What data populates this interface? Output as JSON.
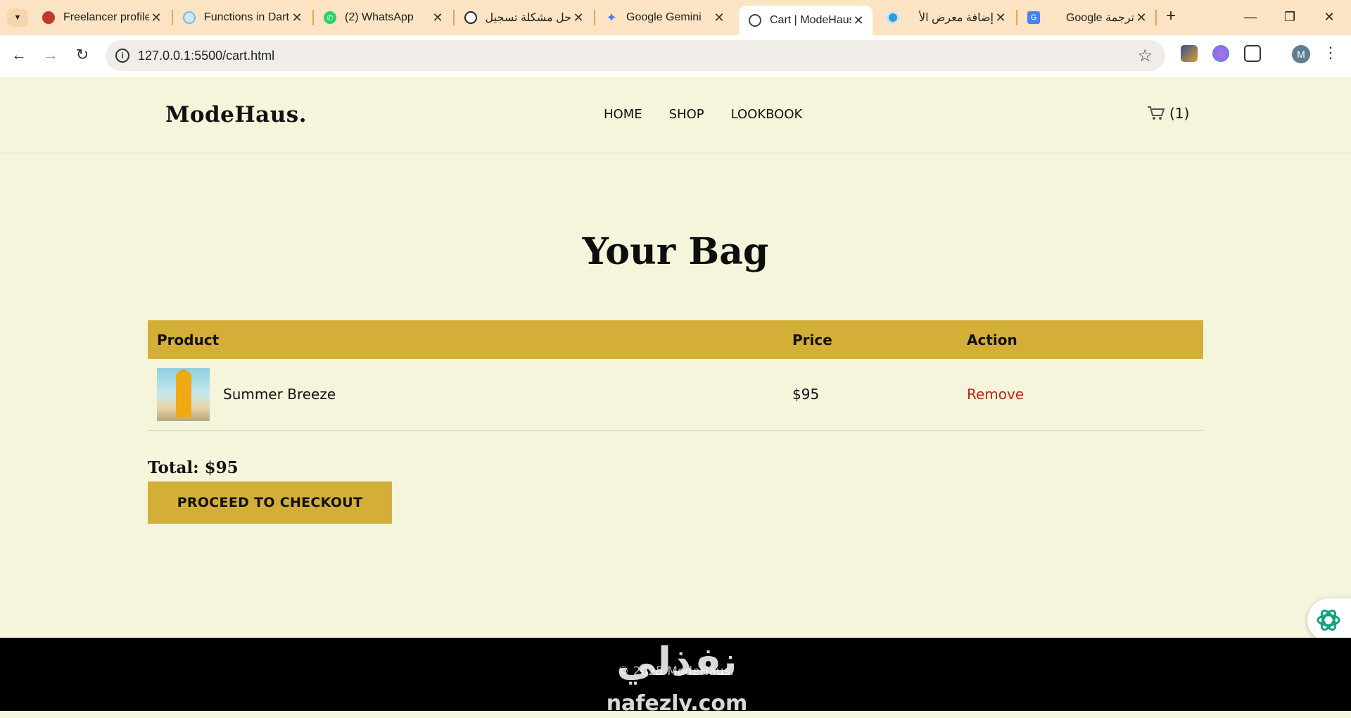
{
  "browser": {
    "tabs": [
      {
        "title": "Freelancer profile",
        "icon": "freelancer-icon",
        "color": "#c0392b"
      },
      {
        "title": "Functions in Dart",
        "icon": "dart-doc-icon",
        "color": "#7fb6d9"
      },
      {
        "title": "(2) WhatsApp",
        "icon": "whatsapp-icon",
        "color": "#25d366"
      },
      {
        "title": "حل مشكلة تسجيل",
        "icon": "chatgpt-icon",
        "color": "#222222"
      },
      {
        "title": "Google Gemini",
        "icon": "gemini-icon",
        "color": "#4f7cf5"
      },
      {
        "title": "Cart | ModeHaus",
        "icon": "globe-icon",
        "color": "#444444",
        "active": true
      },
      {
        "title": "إضافة معرض الأ",
        "icon": "circle-app-icon",
        "color": "#2b9be0"
      },
      {
        "title": "ترجمة Google",
        "icon": "google-translate-icon",
        "color": "#4285f4"
      }
    ],
    "url": "127.0.0.1:5500/cart.html",
    "profile_initial": "M"
  },
  "site": {
    "logo": "ModeHaus.",
    "nav": [
      "HOME",
      "SHOP",
      "LOOKBOOK"
    ],
    "cart_count": "(1)"
  },
  "cart": {
    "title": "Your Bag",
    "columns": [
      "Product",
      "Price",
      "Action"
    ],
    "items": [
      {
        "name": "Summer Breeze",
        "price": "$95",
        "action": "Remove"
      }
    ],
    "total": "Total: $95",
    "checkout_label": "PROCEED TO CHECKOUT"
  },
  "footer": {
    "text": "© 2025 ModeHaus."
  },
  "watermark": {
    "arabic": "نفذلي",
    "latin": "nafezly.com"
  },
  "colors": {
    "page_bg": "#f5f5dc",
    "accent_gold": "#d4af37",
    "remove_red": "#c0221b",
    "tabbar_bg": "#fbe3c3"
  }
}
